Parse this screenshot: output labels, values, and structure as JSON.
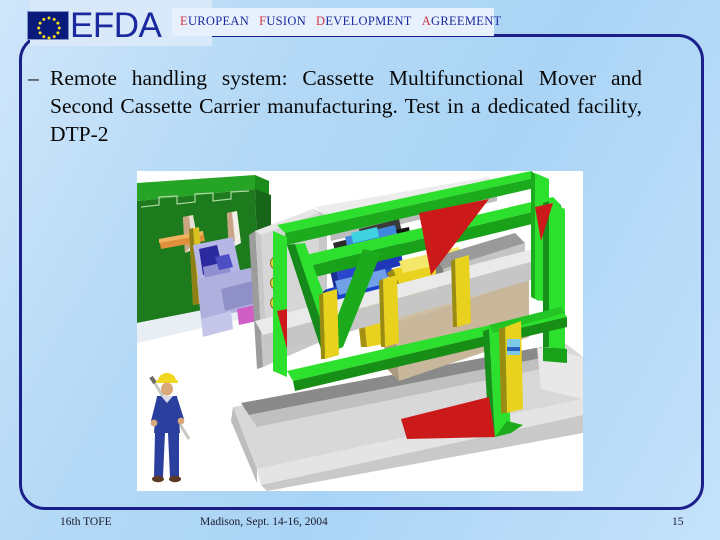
{
  "slide": {
    "background_color": "#b4d9f6",
    "frame_color": "#1a1f8c"
  },
  "header": {
    "logo_text": "EFDA",
    "logo_color": "#1a2a9e",
    "flag_background": "#0a1a7a",
    "flag_star_color": "#f5e01e",
    "tagline_words": [
      {
        "cap": "E",
        "rest": "UROPEAN"
      },
      {
        "cap": "F",
        "rest": "USION"
      },
      {
        "cap": "D",
        "rest": "EVELOPMENT"
      },
      {
        "cap": "A",
        "rest": "GREEMENT"
      }
    ],
    "tagline_cap_color": "#cf3340",
    "tagline_body_color": "#1a2a9e"
  },
  "content": {
    "bullet_marker": "–",
    "bullet_text": "Remote handling system: Cassette Multifunctional Mover and Second Cassette Carrier manufacturing. Test in a dedicated facility, DTP-2"
  },
  "picture": {
    "caption": "",
    "alt": "3D CAD rendering of the Cassette Multifunctional Mover and Second Cassette Carrier on a rail base inside a green test frame, with a human figure for scale",
    "colors": {
      "frame_green": "#22c322",
      "post_yellow": "#e8d21e",
      "gusset_red": "#cc1a1a",
      "cassette_green": "#1d7a1d",
      "body_gray": "#b8b8b8",
      "base_gray": "#d2d2d2",
      "machine_blue": "#2a46cc",
      "worker_overall": "#2a3f9e",
      "worker_helmet": "#f0d61e"
    }
  },
  "footer": {
    "left": "16th TOFE",
    "middle": "Madison, Sept. 14-16, 2004",
    "page_number": "15"
  }
}
